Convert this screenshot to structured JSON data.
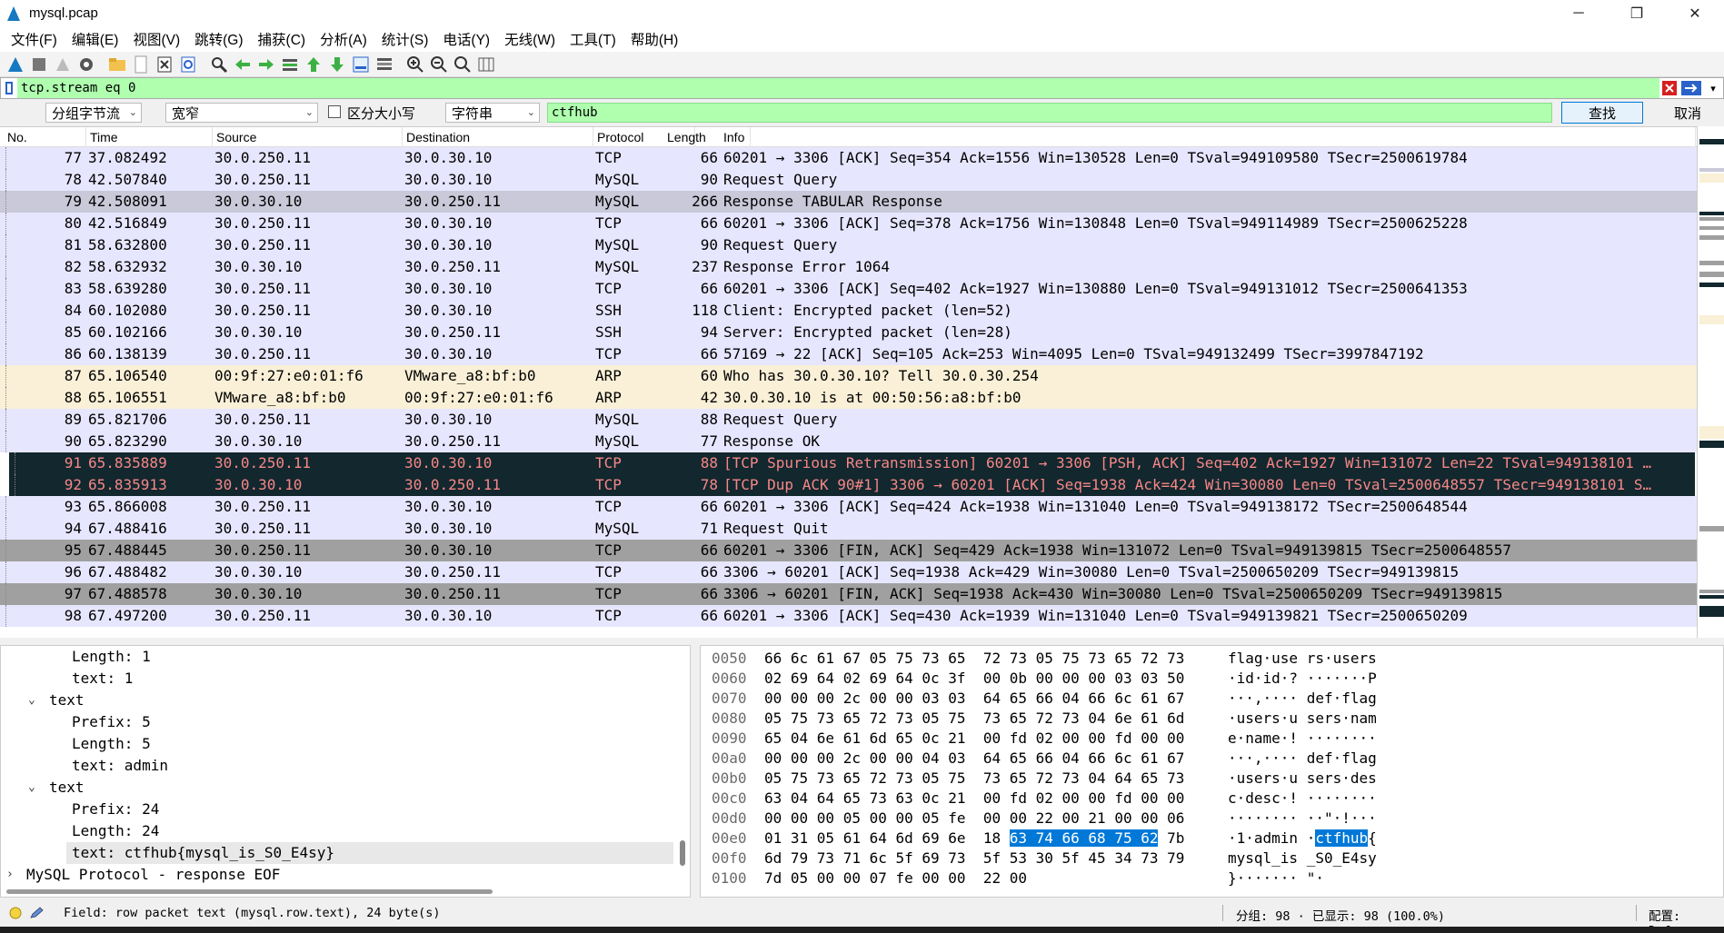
{
  "window": {
    "title": "mysql.pcap",
    "minimize": "─",
    "maximize": "❐",
    "close": "✕"
  },
  "menu": [
    "文件(F)",
    "编辑(E)",
    "视图(V)",
    "跳转(G)",
    "捕获(C)",
    "分析(A)",
    "统计(S)",
    "电话(Y)",
    "无线(W)",
    "工具(T)",
    "帮助(H)"
  ],
  "toolbar_icons": [
    "shark-fin-start-icon",
    "stop-icon",
    "restart-icon",
    "options-gear-icon",
    "open-folder-icon",
    "file-icon",
    "close-file-icon",
    "reload-icon",
    "find-magnifier-icon",
    "back-arrow-icon",
    "forward-arrow-icon",
    "go-to-packet-icon",
    "first-packet-icon",
    "last-packet-icon",
    "autoscroll-icon",
    "colorize-icon",
    "zoom-in-icon",
    "zoom-out-icon",
    "zoom-reset-icon",
    "resize-columns-icon"
  ],
  "display_filter": {
    "value": "tcp.stream eq 0",
    "bg_color": "#afffaf"
  },
  "find": {
    "search_in": "分组字节流",
    "char_width": "宽窄",
    "case_label": "区分大小写",
    "search_type": "字符串",
    "value": "ctfhub",
    "find_button": "查找",
    "cancel_button": "取消"
  },
  "columns": [
    "No.",
    "Time",
    "Source",
    "Destination",
    "Protocol",
    "Length",
    "Info"
  ],
  "colors": {
    "tcp": "#e7e6ff",
    "tcp_fin": "#a0a0a0",
    "arp": "#faf0d7",
    "bad_tcp_bg": "#12272e",
    "bad_tcp_fg": "#f78787",
    "selected": "#c9c9d9",
    "highlight": "#0078d7"
  },
  "packets": [
    {
      "no": "77",
      "time": "37.082492",
      "src": "30.0.250.11",
      "dst": "30.0.30.10",
      "proto": "TCP",
      "len": "66",
      "info": "60201 → 3306 [ACK] Seq=354 Ack=1556 Win=130528 Len=0 TSval=949109580 TSecr=2500619784",
      "style": "tcp"
    },
    {
      "no": "78",
      "time": "42.507840",
      "src": "30.0.250.11",
      "dst": "30.0.30.10",
      "proto": "MySQL",
      "len": "90",
      "info": "Request Query",
      "style": "tcp"
    },
    {
      "no": "79",
      "time": "42.508091",
      "src": "30.0.30.10",
      "dst": "30.0.250.11",
      "proto": "MySQL",
      "len": "266",
      "info": "Response TABULAR Response",
      "style": "selected"
    },
    {
      "no": "80",
      "time": "42.516849",
      "src": "30.0.250.11",
      "dst": "30.0.30.10",
      "proto": "TCP",
      "len": "66",
      "info": "60201 → 3306 [ACK] Seq=378 Ack=1756 Win=130848 Len=0 TSval=949114989 TSecr=2500625228",
      "style": "tcp"
    },
    {
      "no": "81",
      "time": "58.632800",
      "src": "30.0.250.11",
      "dst": "30.0.30.10",
      "proto": "MySQL",
      "len": "90",
      "info": "Request Query",
      "style": "tcp"
    },
    {
      "no": "82",
      "time": "58.632932",
      "src": "30.0.30.10",
      "dst": "30.0.250.11",
      "proto": "MySQL",
      "len": "237",
      "info": "Response  Error 1064",
      "style": "tcp"
    },
    {
      "no": "83",
      "time": "58.639280",
      "src": "30.0.250.11",
      "dst": "30.0.30.10",
      "proto": "TCP",
      "len": "66",
      "info": "60201 → 3306 [ACK] Seq=402 Ack=1927 Win=130880 Len=0 TSval=949131012 TSecr=2500641353",
      "style": "tcp"
    },
    {
      "no": "84",
      "time": "60.102080",
      "src": "30.0.250.11",
      "dst": "30.0.30.10",
      "proto": "SSH",
      "len": "118",
      "info": "Client: Encrypted packet (len=52)",
      "style": "tcp"
    },
    {
      "no": "85",
      "time": "60.102166",
      "src": "30.0.30.10",
      "dst": "30.0.250.11",
      "proto": "SSH",
      "len": "94",
      "info": "Server: Encrypted packet (len=28)",
      "style": "tcp"
    },
    {
      "no": "86",
      "time": "60.138139",
      "src": "30.0.250.11",
      "dst": "30.0.30.10",
      "proto": "TCP",
      "len": "66",
      "info": "57169 → 22 [ACK] Seq=105 Ack=253 Win=4095 Len=0 TSval=949132499 TSecr=3997847192",
      "style": "tcp"
    },
    {
      "no": "87",
      "time": "65.106540",
      "src": "00:9f:27:e0:01:f6",
      "dst": "VMware_a8:bf:b0",
      "proto": "ARP",
      "len": "60",
      "info": "Who has 30.0.30.10? Tell 30.0.30.254",
      "style": "arp"
    },
    {
      "no": "88",
      "time": "65.106551",
      "src": "VMware_a8:bf:b0",
      "dst": "00:9f:27:e0:01:f6",
      "proto": "ARP",
      "len": "42",
      "info": "30.0.30.10 is at 00:50:56:a8:bf:b0",
      "style": "arp"
    },
    {
      "no": "89",
      "time": "65.821706",
      "src": "30.0.250.11",
      "dst": "30.0.30.10",
      "proto": "MySQL",
      "len": "88",
      "info": "Request Query",
      "style": "tcp"
    },
    {
      "no": "90",
      "time": "65.823290",
      "src": "30.0.30.10",
      "dst": "30.0.250.11",
      "proto": "MySQL",
      "len": "77",
      "info": "Response  OK",
      "style": "tcp"
    },
    {
      "no": "91",
      "time": "65.835889",
      "src": "30.0.250.11",
      "dst": "30.0.30.10",
      "proto": "TCP",
      "len": "88",
      "info": "[TCP Spurious Retransmission] 60201 → 3306 [PSH, ACK] Seq=402 Ack=1927 Win=131072 Len=22 TSval=949138101 …",
      "style": "bad"
    },
    {
      "no": "92",
      "time": "65.835913",
      "src": "30.0.30.10",
      "dst": "30.0.250.11",
      "proto": "TCP",
      "len": "78",
      "info": "[TCP Dup ACK 90#1] 3306 → 60201 [ACK] Seq=1938 Ack=424 Win=30080 Len=0 TSval=2500648557 TSecr=949138101 S…",
      "style": "bad"
    },
    {
      "no": "93",
      "time": "65.866008",
      "src": "30.0.250.11",
      "dst": "30.0.30.10",
      "proto": "TCP",
      "len": "66",
      "info": "60201 → 3306 [ACK] Seq=424 Ack=1938 Win=131040 Len=0 TSval=949138172 TSecr=2500648544",
      "style": "tcp"
    },
    {
      "no": "94",
      "time": "67.488416",
      "src": "30.0.250.11",
      "dst": "30.0.30.10",
      "proto": "MySQL",
      "len": "71",
      "info": "Request Quit",
      "style": "tcp"
    },
    {
      "no": "95",
      "time": "67.488445",
      "src": "30.0.250.11",
      "dst": "30.0.30.10",
      "proto": "TCP",
      "len": "66",
      "info": "60201 → 3306 [FIN, ACK] Seq=429 Ack=1938 Win=131072 Len=0 TSval=949139815 TSecr=2500648557",
      "style": "fin"
    },
    {
      "no": "96",
      "time": "67.488482",
      "src": "30.0.30.10",
      "dst": "30.0.250.11",
      "proto": "TCP",
      "len": "66",
      "info": "3306 → 60201 [ACK] Seq=1938 Ack=429 Win=30080 Len=0 TSval=2500650209 TSecr=949139815",
      "style": "tcp"
    },
    {
      "no": "97",
      "time": "67.488578",
      "src": "30.0.30.10",
      "dst": "30.0.250.11",
      "proto": "TCP",
      "len": "66",
      "info": "3306 → 60201 [FIN, ACK] Seq=1938 Ack=430 Win=30080 Len=0 TSval=2500650209 TSecr=949139815",
      "style": "fin"
    },
    {
      "no": "98",
      "time": "67.497200",
      "src": "30.0.250.11",
      "dst": "30.0.30.10",
      "proto": "TCP",
      "len": "66",
      "info": "60201 → 3306 [ACK] Seq=430 Ack=1939 Win=131040 Len=0 TSval=949139821 TSecr=2500650209",
      "style": "tcp"
    }
  ],
  "details": [
    {
      "text": "Length: 1",
      "level": 3,
      "arrow": ""
    },
    {
      "text": "text: 1",
      "level": 3,
      "arrow": ""
    },
    {
      "text": "text",
      "level": 2,
      "arrow": "⌄"
    },
    {
      "text": "Prefix: 5",
      "level": 3,
      "arrow": ""
    },
    {
      "text": "Length: 5",
      "level": 3,
      "arrow": ""
    },
    {
      "text": "text: admin",
      "level": 3,
      "arrow": ""
    },
    {
      "text": "text",
      "level": 2,
      "arrow": "⌄"
    },
    {
      "text": "Prefix: 24",
      "level": 3,
      "arrow": ""
    },
    {
      "text": "Length: 24",
      "level": 3,
      "arrow": ""
    },
    {
      "text": "text: ctfhub{mysql_is_S0_E4sy}",
      "level": 3,
      "arrow": "",
      "selected": true
    },
    {
      "text": "MySQL Protocol - response EOF",
      "level": 1,
      "arrow": "›"
    }
  ],
  "bytes": [
    {
      "off": "0050",
      "hex": "66 6c 61 67 05 75 73 65  72 73 05 75 73 65 72 73",
      "ascii": "flag·use rs·users"
    },
    {
      "off": "0060",
      "hex": "02 69 64 02 69 64 0c 3f  00 0b 00 00 00 03 03 50",
      "ascii": "·id·id·? ·······P"
    },
    {
      "off": "0070",
      "hex": "00 00 00 2c 00 00 03 03  64 65 66 04 66 6c 61 67",
      "ascii": "···,···· def·flag"
    },
    {
      "off": "0080",
      "hex": "05 75 73 65 72 73 05 75  73 65 72 73 04 6e 61 6d",
      "ascii": "·users·u sers·nam"
    },
    {
      "off": "0090",
      "hex": "65 04 6e 61 6d 65 0c 21  00 fd 02 00 00 fd 00 00",
      "ascii": "e·name·! ········"
    },
    {
      "off": "00a0",
      "hex": "00 00 00 2c 00 00 04 03  64 65 66 04 66 6c 61 67",
      "ascii": "···,···· def·flag"
    },
    {
      "off": "00b0",
      "hex": "05 75 73 65 72 73 05 75  73 65 72 73 04 64 65 73",
      "ascii": "·users·u sers·des"
    },
    {
      "off": "00c0",
      "hex": "63 04 64 65 73 63 0c 21  00 fd 02 00 00 fd 00 00",
      "ascii": "c·desc·! ········"
    },
    {
      "off": "00d0",
      "hex": "00 00 00 05 00 00 05 fe  00 00 22 00 21 00 00 06",
      "ascii": "········ ··\"·!···"
    },
    {
      "off": "00e0",
      "hex_pre": "01 31 05 61 64 6d 69 6e  18 ",
      "hex_hl": "63 74 66 68 75 62",
      "hex_post": " 7b",
      "ascii_pre": "·1·admin ·",
      "ascii_hl": "ctfhub",
      "ascii_post": "{"
    },
    {
      "off": "00f0",
      "hex": "6d 79 73 71 6c 5f 69 73  5f 53 30 5f 45 34 73 79",
      "ascii": "mysql_is _S0_E4sy"
    },
    {
      "off": "0100",
      "hex": "7d 05 00 00 07 fe 00 00  22 00",
      "ascii": "}······· \"·"
    }
  ],
  "status": {
    "field": "Field: row packet text (mysql.row.text), 24 byte(s)",
    "packets": "分组: 98 · 已显示: 98 (100.0%)",
    "profile": "配置: Defau"
  }
}
